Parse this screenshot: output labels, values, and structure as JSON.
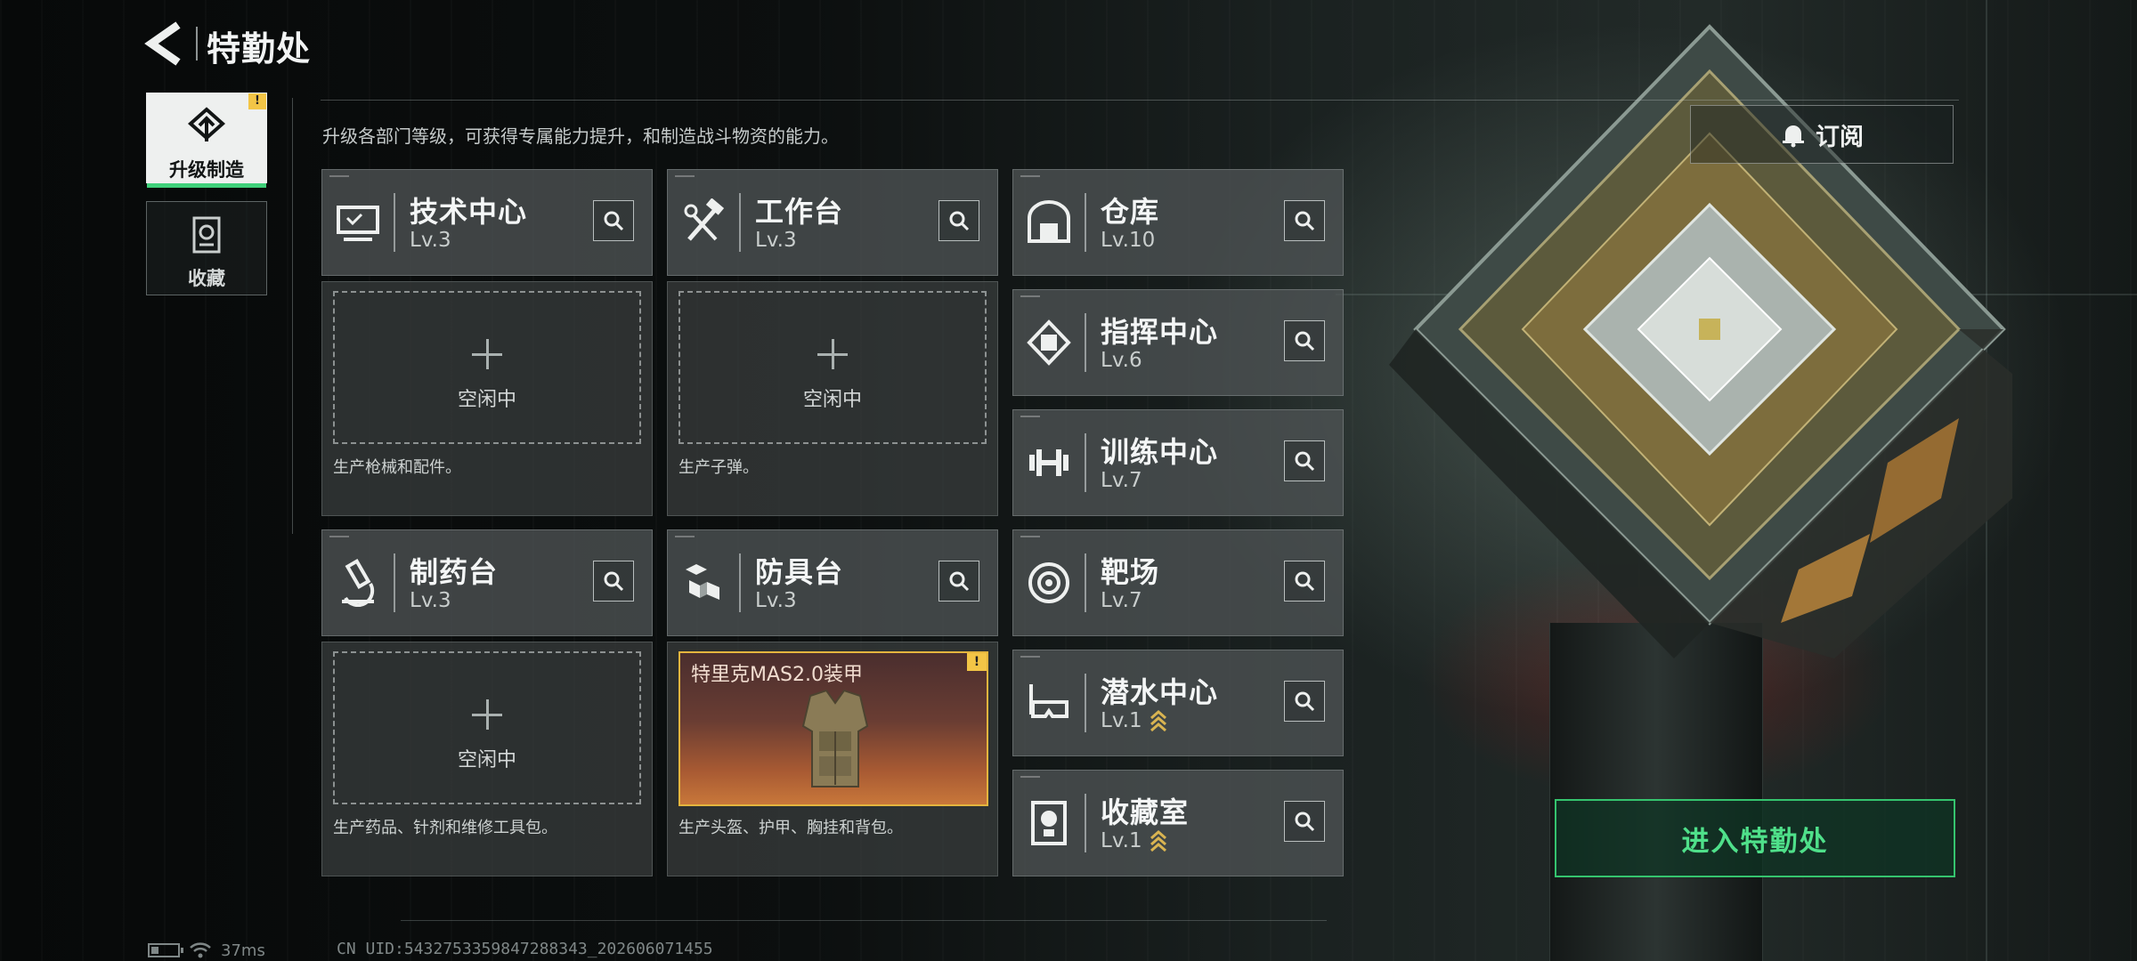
{
  "header": {
    "title": "特勤处"
  },
  "tabs": [
    {
      "label": "升级制造",
      "active": true,
      "badge": "!"
    },
    {
      "label": "收藏",
      "active": false
    }
  ],
  "description": "升级各部门等级，可获得专属能力提升，和制造战斗物资的能力。",
  "subscribe": {
    "label": "订阅",
    "icon": "bell-icon"
  },
  "stations": [
    {
      "name": "技术中心",
      "level": "Lv.3",
      "icon": "monitor-icon"
    },
    {
      "name": "工作台",
      "level": "Lv.3",
      "icon": "hammer-wrench-icon"
    },
    {
      "name": "制药台",
      "level": "Lv.3",
      "icon": "microscope-icon"
    },
    {
      "name": "防具台",
      "level": "Lv.3",
      "icon": "armor-blocks-icon"
    }
  ],
  "slots": [
    {
      "status": "空闲中",
      "desc": "生产枪械和配件。"
    },
    {
      "status": "空闲中",
      "desc": "生产子弹。"
    },
    {
      "status": "空闲中",
      "desc": "生产药品、针剂和维修工具包。"
    },
    {
      "desc": "生产头盔、护甲、胸挂和背包。",
      "product": "特里克MAS2.0装甲",
      "badge": "!"
    }
  ],
  "departments": [
    {
      "name": "仓库",
      "level": "Lv.10",
      "icon": "warehouse-icon"
    },
    {
      "name": "指挥中心",
      "level": "Lv.6",
      "icon": "chip-icon"
    },
    {
      "name": "训练中心",
      "level": "Lv.7",
      "icon": "dumbbell-icon"
    },
    {
      "name": "靶场",
      "level": "Lv.7",
      "icon": "target-icon"
    },
    {
      "name": "潜水中心",
      "level": "Lv.1",
      "icon": "diving-mask-icon",
      "upgradable": true
    },
    {
      "name": "收藏室",
      "level": "Lv.1",
      "icon": "trophy-icon",
      "upgradable": true
    }
  ],
  "enter_button": {
    "label": "进入特勤处"
  },
  "status": {
    "ping": "37ms",
    "uid": "CN UID:5432753359847288343_202606071455"
  },
  "colors": {
    "accent_green": "#3fd07a",
    "badge_yellow": "#f3c546",
    "product_border": "#e4b53e"
  }
}
